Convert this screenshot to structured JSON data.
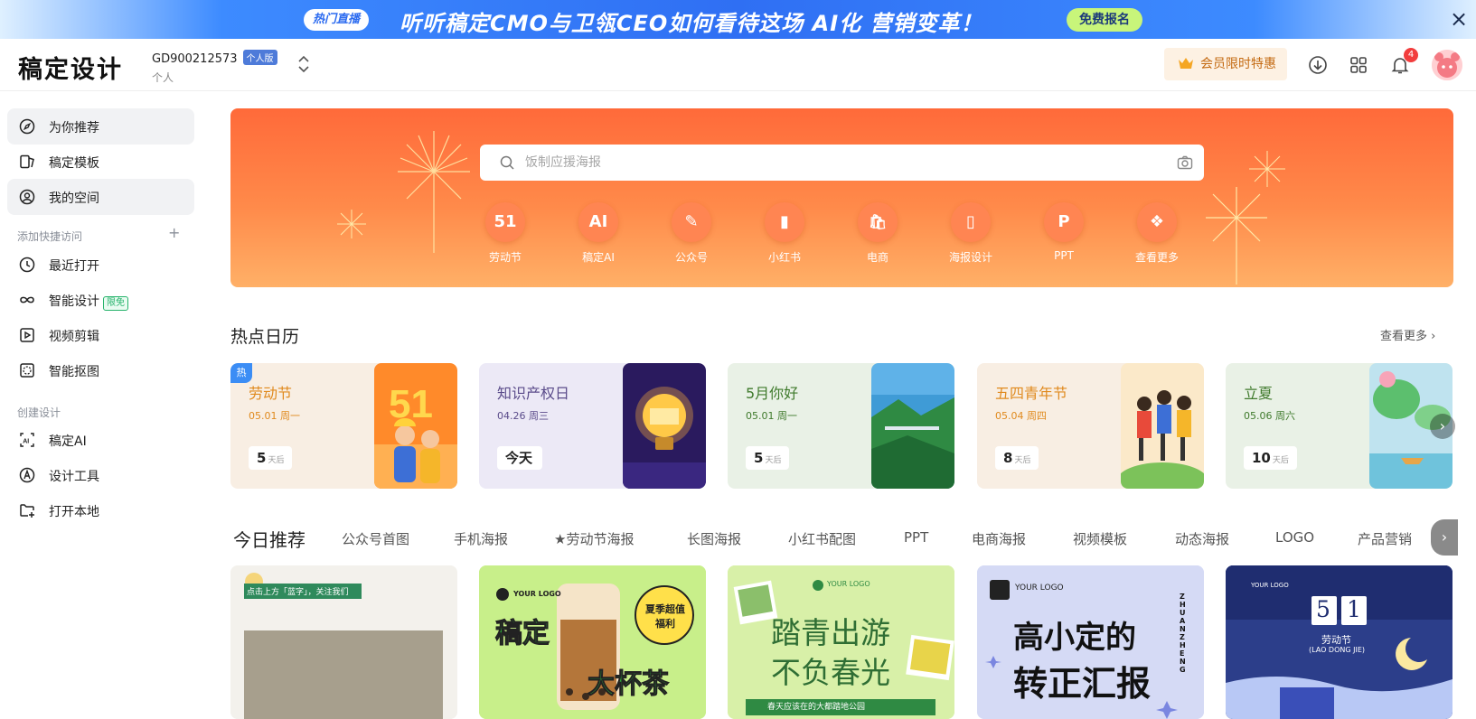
{
  "banner": {
    "live_tag": "热门直播",
    "headline": "听听稿定CMO与卫瓴CEO如何看待这场 AI化 营销变革！",
    "signup": "免费报名",
    "close": "×"
  },
  "header": {
    "logo": "稿定设计",
    "account_id": "GD900212573",
    "plan_badge": "个人版",
    "account_type": "个人",
    "vip_button": "会员限时特惠",
    "notification_count": "4"
  },
  "sidebar": {
    "items": [
      {
        "label": "为你推荐",
        "icon": "compass-icon",
        "active": true
      },
      {
        "label": "稿定模板",
        "icon": "template-icon",
        "active": false
      },
      {
        "label": "我的空间",
        "icon": "user-circle-icon",
        "active": true
      }
    ],
    "quick_access": {
      "title": "添加快捷访问",
      "plus": "+",
      "items": [
        {
          "label": "最近打开",
          "icon": "clock-icon"
        },
        {
          "label": "智能设计",
          "icon": "infinity-icon",
          "tag": "限免"
        },
        {
          "label": "视频剪辑",
          "icon": "video-play-icon"
        },
        {
          "label": "智能抠图",
          "icon": "cutout-icon"
        }
      ]
    },
    "create": {
      "title": "创建设计",
      "items": [
        {
          "label": "稿定AI",
          "icon": "ai-icon"
        },
        {
          "label": "设计工具",
          "icon": "design-tool-icon"
        },
        {
          "label": "打开本地",
          "icon": "open-local-icon"
        }
      ]
    }
  },
  "hero": {
    "search_placeholder": "饭制应援海报",
    "categories": [
      {
        "label": "劳动节",
        "glyph": "51"
      },
      {
        "label": "稿定AI",
        "glyph": "AI"
      },
      {
        "label": "公众号",
        "glyph": "✎"
      },
      {
        "label": "小红书",
        "glyph": "▮"
      },
      {
        "label": "电商",
        "glyph": "🛍"
      },
      {
        "label": "海报设计",
        "glyph": "▯"
      },
      {
        "label": "PPT",
        "glyph": "P"
      },
      {
        "label": "查看更多",
        "glyph": "❖"
      }
    ]
  },
  "calendar": {
    "title": "热点日历",
    "more": "查看更多",
    "hot_tag": "热",
    "cards": [
      {
        "title": "劳动节",
        "date": "05.01 周一",
        "count": "5",
        "unit": "天后",
        "bg": "#f8eee3",
        "color": "#e08a1e"
      },
      {
        "title": "知识产权日",
        "date": "04.26 周三",
        "count": "今天",
        "unit": "",
        "bg": "#ece9f6",
        "color": "#5a4b8a"
      },
      {
        "title": "5月你好",
        "date": "05.01 周一",
        "count": "5",
        "unit": "天后",
        "bg": "#e9f1e6",
        "color": "#3f7a2c"
      },
      {
        "title": "五四青年节",
        "date": "05.04 周四",
        "count": "8",
        "unit": "天后",
        "bg": "#f8eee3",
        "color": "#e08a1e"
      },
      {
        "title": "立夏",
        "date": "05.06 周六",
        "count": "10",
        "unit": "天后",
        "bg": "#e9f1e6",
        "color": "#3f7a2c"
      }
    ]
  },
  "today": {
    "title": "今日推荐",
    "tabs": [
      "公众号首图",
      "手机海报",
      "★劳动节海报",
      "长图海报",
      "小红书配图",
      "PPT",
      "电商海报",
      "视频模板",
      "动态海报",
      "LOGO",
      "产品营销"
    ]
  },
  "templates": [
    {
      "caption": "点击上方「蓝字」，关注我们"
    },
    {
      "logo": "YOUR LOGO",
      "big": "稿定",
      "big2": "大杯茶",
      "tag": "夏季超值福利"
    },
    {
      "logo": "YOUR LOGO",
      "line1": "踏青出游",
      "line2": "不负春光",
      "footer": "春天应该在的大都踏地公园"
    },
    {
      "logo": "YOUR LOGO",
      "line1": "高小定的",
      "line2": "转正汇报",
      "side": "ZHUAN ZHENG"
    },
    {
      "logo": "YOUR LOGO",
      "d1": "5",
      "d2": "1",
      "title": "劳动节",
      "sub": "(LAO DONG JIE)"
    }
  ]
}
